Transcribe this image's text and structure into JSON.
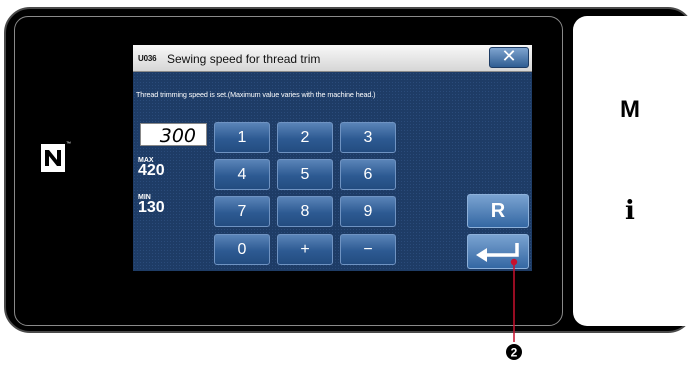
{
  "dialog": {
    "code": "U036",
    "title": "Sewing speed for thread trim",
    "close_label": "✕",
    "description": "Thread trimming speed is set.(Maximum value varies with the machine head.)",
    "value": "300",
    "max_label": "MAX",
    "max_value": "420",
    "min_label": "MIN",
    "min_value": "130",
    "keys": [
      "1",
      "2",
      "3",
      "4",
      "5",
      "6",
      "7",
      "8",
      "9",
      "0",
      "+",
      "−"
    ],
    "reset_label": "R"
  },
  "side_panel": {
    "m_label": "M",
    "i_label": "i"
  },
  "nfc": {
    "tm": "™"
  },
  "callout": {
    "number": "2"
  },
  "colors": {
    "dialog_bg": "#1e3c66",
    "key": "#2d5a92",
    "callout": "#c8102e"
  }
}
